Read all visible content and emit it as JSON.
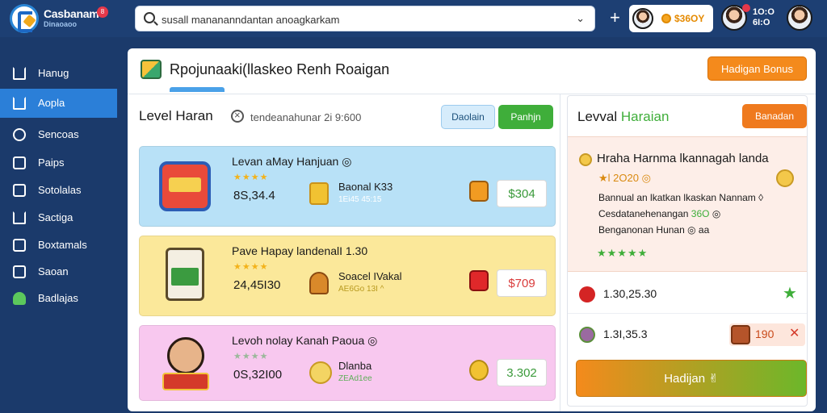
{
  "app": {
    "brand": "Casbanam",
    "brand_sub": "Dinaoaoo",
    "badge": "8"
  },
  "search": {
    "value": "susall manananndantan anoagkarkam",
    "placeholder": "susall manananndantan anoagkarkam"
  },
  "topbar": {
    "plus": "+",
    "coins": "$36OY",
    "stats_line1": "1O:O",
    "stats_line2": "6I:O"
  },
  "sidebar": {
    "items": [
      {
        "label": "Hanug",
        "icon": "home-icon"
      },
      {
        "label": "Aopla",
        "icon": "home-icon"
      },
      {
        "label": "Sencoas",
        "icon": "tag-icon"
      },
      {
        "label": "Paips",
        "icon": "document-icon"
      },
      {
        "label": "Sotolalas",
        "icon": "chart-icon"
      },
      {
        "label": "Sactiga",
        "icon": "home-icon"
      },
      {
        "label": "Boxtamals",
        "icon": "list-icon"
      },
      {
        "label": "Saoan",
        "icon": "list-icon"
      },
      {
        "label": "Badlajas",
        "icon": "user-icon"
      }
    ]
  },
  "page": {
    "title": "Rpojunaaki(llaskeo Renh Roaigan",
    "bonus_button": "Hadigan Bonus"
  },
  "level_section": {
    "title": "Level Haran",
    "filter_text": "tendeanahunar 2i 9:600",
    "detail_button": "Daolain",
    "green_button": "Panhjn"
  },
  "cards": [
    {
      "name": "Levan aMay Hanjuan ◎",
      "stars": "★★★★",
      "amount": "8S,34.4",
      "item_name": "Baonal K33",
      "item_sub": "1Ei45 45:15",
      "price": "$304"
    },
    {
      "name": "Pave Hapay landenalI 1.30",
      "stars": "★★★★",
      "amount": "24,45I30",
      "item_name": "Soacel IVakal",
      "item_sub": "AE6Go 13I ^",
      "price": "$709"
    },
    {
      "name": "Levoh nolay Kanah Paoua ◎",
      "stars": "★★★★",
      "amount": "0S,32I00",
      "item_name": "Dlanba",
      "item_sub": "ZEAd1ee",
      "price": "3.302"
    }
  ],
  "right_panel": {
    "title": "Levval",
    "title_accent": "Haraian",
    "button": "Banadan",
    "info_title": "Hraha Harnma lkannagah landa",
    "info_sub": "★l 2O20 ◎",
    "line1": "Bannual an lkatkan lkaskan Nannam",
    "line1_tail": "◊",
    "line2_prefix": "Cesdatanehenangan",
    "line2_value": "36O",
    "line2_suffix": "◎",
    "line3": "Benganonan Hunan ◎ aa",
    "stars": "★★★★★",
    "row1_value": "1.30,25.30",
    "row2_value": "1.3I,35.3",
    "chip_value": "190",
    "cta": "Hadijan ✌"
  },
  "colors": {
    "topbar": "#1d3f73",
    "sidebar": "#1b3a6b",
    "active": "#2b7fd8",
    "accent_orange": "#f48a1c",
    "accent_green": "#3fae3a"
  }
}
